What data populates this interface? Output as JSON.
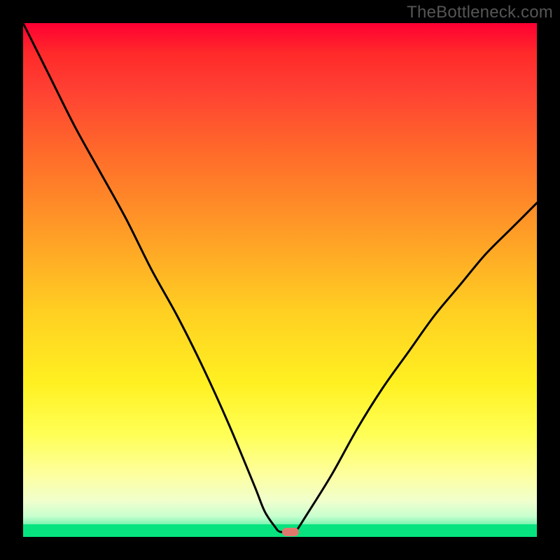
{
  "watermark": "TheBottleneck.com",
  "colors": {
    "frame_bg": "#000000",
    "curve_stroke": "#000000",
    "marker": "#e0796d",
    "gradient_top": "#ff0033",
    "gradient_bottom": "#07e47f"
  },
  "chart_data": {
    "type": "line",
    "title": "",
    "xlabel": "",
    "ylabel": "",
    "xlim": [
      0,
      100
    ],
    "ylim": [
      0,
      100
    ],
    "grid": false,
    "legend": false,
    "x": [
      0,
      5,
      10,
      15,
      20,
      25,
      30,
      35,
      40,
      45,
      47,
      49,
      50,
      52,
      53,
      55,
      60,
      65,
      70,
      75,
      80,
      85,
      90,
      95,
      100
    ],
    "values": [
      100,
      90,
      80,
      71,
      62,
      52,
      43,
      33,
      22,
      10,
      5,
      2,
      1,
      1,
      1,
      4,
      12,
      21,
      29,
      36,
      43,
      49,
      55,
      60,
      65
    ],
    "marker": {
      "x": 52,
      "y": 1
    },
    "notes": "Values are bottleneck percentages read by vertical position along the color gradient (100 = top/red = severe bottleneck, 0 = bottom/green = no bottleneck). The curve dips to a flat minimum near x≈50–53, rising more steeply on the left than the right. Axis ticks are not shown; x is normalized 0–100."
  }
}
